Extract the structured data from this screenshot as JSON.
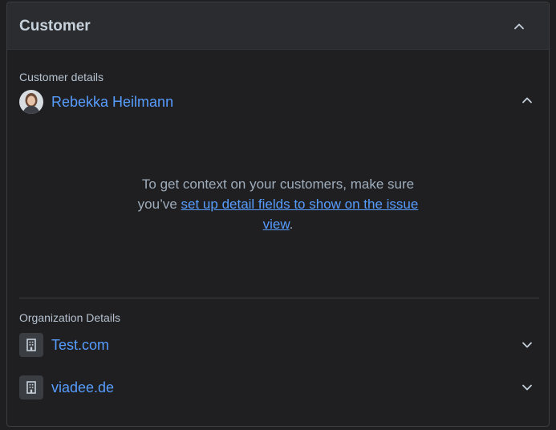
{
  "panel": {
    "title": "Customer"
  },
  "customer_details": {
    "label": "Customer details",
    "name": "Rebekka Heilmann",
    "message_prefix": "To get context on your customers, make sure you’ve ",
    "message_link": "set up detail fields to show on the issue view",
    "message_suffix": "."
  },
  "organization_details": {
    "label": "Organization Details",
    "items": [
      {
        "name": "Test.com"
      },
      {
        "name": "viadee.de"
      }
    ]
  },
  "colors": {
    "link": "#579dff",
    "text": "#b6c2cf",
    "background": "#1f1f21",
    "header_bg": "#2b2c2f"
  },
  "icons": {
    "collapse": "chevron-up-icon",
    "expand": "chevron-down-icon",
    "organization": "building-icon"
  }
}
